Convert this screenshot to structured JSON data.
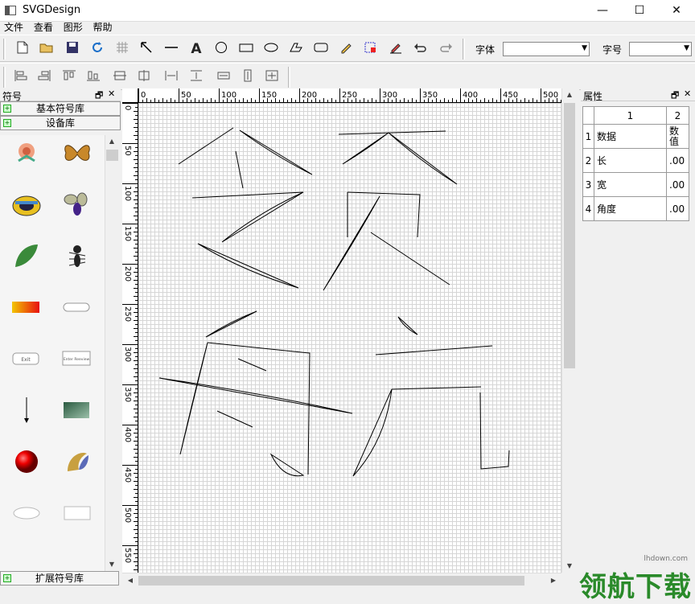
{
  "window": {
    "title": "SVGDesign",
    "minimize": "—",
    "maximize": "☐",
    "close": "✕"
  },
  "menu": [
    "文件",
    "查看",
    "图形",
    "帮助"
  ],
  "toolbar1": {
    "font_label": "字体",
    "font_value": "",
    "size_label": "字号",
    "size_value": ""
  },
  "symbols_panel": {
    "title": "符号",
    "tab_basic": "基本符号库",
    "tab_device": "设备库",
    "tab_extended": "扩展符号库",
    "button_small_text_1": "Exit",
    "button_small_text_2": "Enter Reeview"
  },
  "ruler": {
    "h_labels": [
      "0",
      "50",
      "100",
      "150",
      "200",
      "250",
      "300",
      "350",
      "400",
      "450",
      "500"
    ],
    "v_labels": [
      "0",
      "50",
      "100",
      "150",
      "200",
      "250",
      "300",
      "350",
      "400",
      "450",
      "500",
      "550"
    ]
  },
  "properties": {
    "title": "属性",
    "col1": "1",
    "col2": "2",
    "rows": [
      {
        "n": "1",
        "name": "数据",
        "value": "数值"
      },
      {
        "n": "2",
        "name": "长",
        "value": ".00"
      },
      {
        "n": "3",
        "name": "宽",
        "value": ".00"
      },
      {
        "n": "4",
        "name": "角度",
        "value": ".00"
      }
    ]
  },
  "watermark": {
    "url": "lhdown.com",
    "text": "领航下载"
  }
}
